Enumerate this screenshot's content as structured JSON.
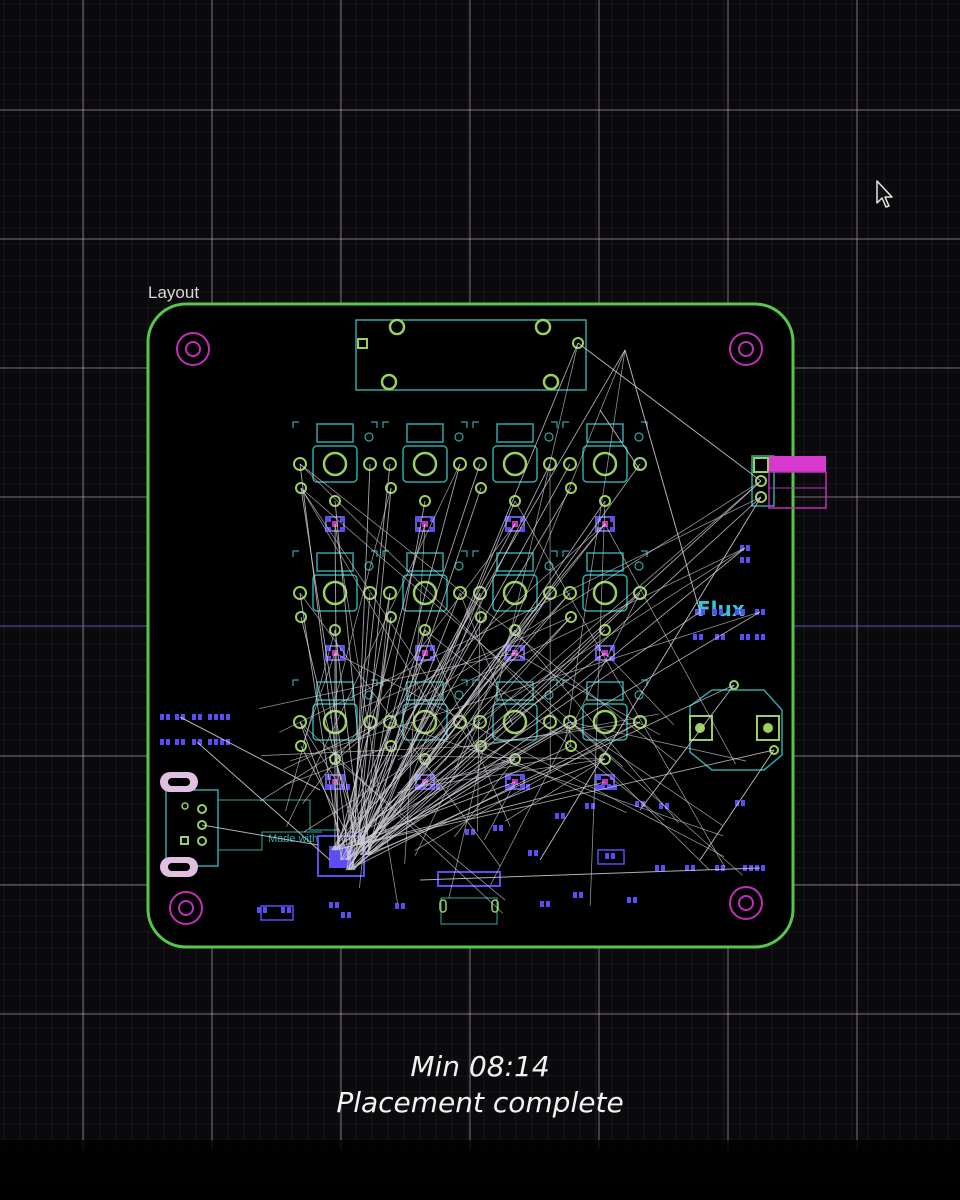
{
  "canvas": {
    "title": "Layout",
    "board_logo": "Flux",
    "silkscreen_text": "Made with"
  },
  "status": {
    "time_label": "Min 08:14",
    "message": "Placement complete"
  },
  "colors": {
    "background": "#0a090b",
    "grid_minor": "#26232a",
    "grid_major": "#d9c6d6",
    "board_outline": "#55c84a",
    "pad_green": "#9ad15a",
    "pad_magenta": "#c02fb8",
    "smd_blue": "#5b4df2",
    "logo_cyan": "#35c4d8",
    "ratsnest": "#cfcfd6"
  },
  "icons": {
    "cursor": "mouse-pointer-icon"
  }
}
